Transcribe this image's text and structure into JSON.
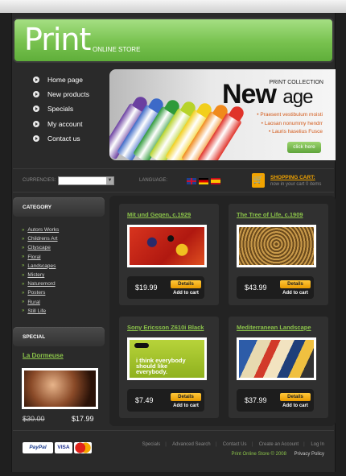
{
  "header": {
    "logo": "Print",
    "tagline": "ONLINE STORE"
  },
  "nav": [
    {
      "label": "Home page"
    },
    {
      "label": "New products"
    },
    {
      "label": "Specials"
    },
    {
      "label": "My account"
    },
    {
      "label": "Contact us"
    }
  ],
  "banner": {
    "subtitle": "PRINT COLLECTION",
    "title_main": "New",
    "title_accent": "age",
    "lines": [
      "Praesent vestibulum moisti",
      "Laosan nonummy hendrr",
      "Lauris  haselius  Fusce"
    ],
    "button": "click here",
    "crayon_colors": [
      "#6a3fa0",
      "#3d6ac8",
      "#2f9a3a",
      "#b7d32a",
      "#f2cf1c",
      "#f08a1c",
      "#e0332a"
    ]
  },
  "utility": {
    "currencies_label": "CURRENCIES:",
    "language_label": "LANGUAGE:",
    "cart_title": "SHOPPING CART:",
    "cart_sub": "now in your cart 0 items"
  },
  "sidebar": {
    "category_heading": "CATEGORY",
    "categories": [
      "Autors Works",
      "Childrens Art",
      "Cityscape",
      "Floral",
      "Landscapes",
      "Mistery",
      "Naturemord",
      "Posters",
      "Rural",
      "Still Life"
    ],
    "special_heading": "SPECIAL",
    "special": {
      "name": "La Dormeuse",
      "old_price": "$30.00",
      "new_price": "$17.99"
    }
  },
  "products": [
    {
      "title": "Mit und Gegen, c.1929",
      "price": "$19.99",
      "details": "Details",
      "add": "Add to cart"
    },
    {
      "title": "The Tree of Life, c.1909",
      "price": "$43.99",
      "details": "Details",
      "add": "Add to cart"
    },
    {
      "title": "Sony Ericsson Z610i Black",
      "price": "$7.49",
      "details": "Details",
      "add": "Add to cart",
      "img_text": "i think everybody should like everybody."
    },
    {
      "title": "Mediterranean Landscape",
      "price": "$37.99",
      "details": "Details",
      "add": "Add to cart"
    }
  ],
  "footer": {
    "payments": [
      "PayPal",
      "VISA",
      "MC"
    ],
    "links": [
      "Specials",
      "Advanced Search",
      "Contact Us",
      "Create an Account",
      "Log In"
    ],
    "copyright": "Print Online Store © 2008",
    "privacy": "Privacy Policy"
  }
}
